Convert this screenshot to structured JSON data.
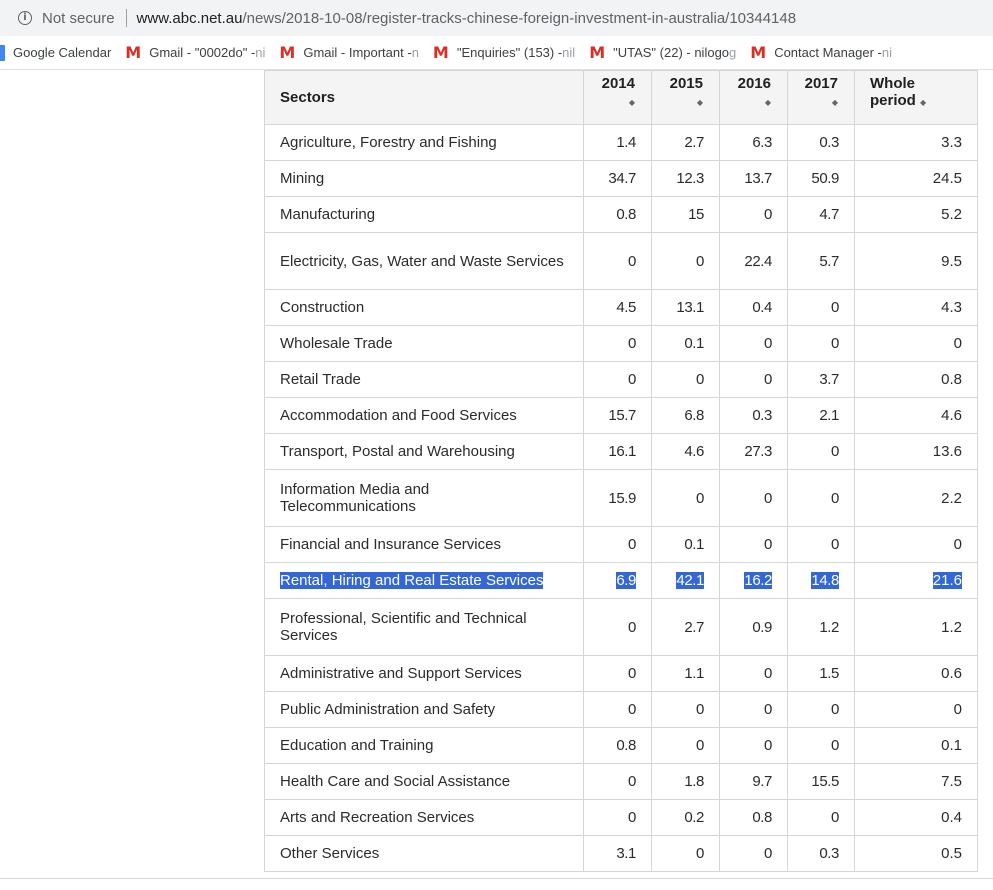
{
  "browser": {
    "security": "Not secure",
    "url_host": "www.abc.net.au",
    "url_path": "/news/2018-10-08/register-tracks-chinese-foreign-investment-in-australia/10344148"
  },
  "bookmarks": [
    {
      "label": "Google Calendar",
      "tail": "",
      "icon": "calendar-icon"
    },
    {
      "label": "Gmail - \"0002do\" - ",
      "tail": "ni",
      "icon": "gmail-icon"
    },
    {
      "label": "Gmail - Important - ",
      "tail": "n",
      "icon": "gmail-icon"
    },
    {
      "label": "\"Enquiries\" (153) - ",
      "tail": "nil",
      "icon": "gmail-icon"
    },
    {
      "label": "\"UTAS\" (22) - nilogo",
      "tail": "g",
      "icon": "gmail-icon"
    },
    {
      "label": "Contact Manager - ",
      "tail": "ni",
      "icon": "gmail-icon"
    }
  ],
  "table": {
    "headers": {
      "sector": "Sectors",
      "y2014": "2014",
      "y2015": "2015",
      "y2016": "2016",
      "y2017": "2017",
      "whole1": "Whole",
      "whole2": "period",
      "sort_glyph": "◆"
    },
    "rows": [
      {
        "sector": "Agriculture, Forestry and Fishing",
        "v": [
          "1.4",
          "2.7",
          "6.3",
          "0.3",
          "3.3"
        ]
      },
      {
        "sector": "Mining",
        "v": [
          "34.7",
          "12.3",
          "13.7",
          "50.9",
          "24.5"
        ]
      },
      {
        "sector": "Manufacturing",
        "v": [
          "0.8",
          "15",
          "0",
          "4.7",
          "5.2"
        ]
      },
      {
        "sector": "Electricity, Gas, Water and Waste Services",
        "v": [
          "0",
          "0",
          "22.4",
          "5.7",
          "9.5"
        ]
      },
      {
        "sector": "Construction",
        "v": [
          "4.5",
          "13.1",
          "0.4",
          "0",
          "4.3"
        ]
      },
      {
        "sector": "Wholesale Trade",
        "v": [
          "0",
          "0.1",
          "0",
          "0",
          "0"
        ]
      },
      {
        "sector": "Retail Trade",
        "v": [
          "0",
          "0",
          "0",
          "3.7",
          "0.8"
        ]
      },
      {
        "sector": "Accommodation and Food Services",
        "v": [
          "15.7",
          "6.8",
          "0.3",
          "2.1",
          "4.6"
        ]
      },
      {
        "sector": "Transport, Postal and Warehousing",
        "v": [
          "16.1",
          "4.6",
          "27.3",
          "0",
          "13.6"
        ]
      },
      {
        "sector": "Information Media and Telecommunications",
        "v": [
          "15.9",
          "0",
          "0",
          "0",
          "2.2"
        ]
      },
      {
        "sector": "Financial and Insurance Services",
        "v": [
          "0",
          "0.1",
          "0",
          "0",
          "0"
        ]
      },
      {
        "sector": "Rental, Hiring and Real Estate Services",
        "v": [
          "6.9",
          "42.1",
          "16.2",
          "14.8",
          "21.6"
        ],
        "highlight": true
      },
      {
        "sector": "Professional, Scientific and Technical Services",
        "v": [
          "0",
          "2.7",
          "0.9",
          "1.2",
          "1.2"
        ]
      },
      {
        "sector": "Administrative and Support Services",
        "v": [
          "0",
          "1.1",
          "0",
          "1.5",
          "0.6"
        ]
      },
      {
        "sector": "Public Administration and Safety",
        "v": [
          "0",
          "0",
          "0",
          "0",
          "0"
        ]
      },
      {
        "sector": "Education and Training",
        "v": [
          "0.8",
          "0",
          "0",
          "0",
          "0.1"
        ]
      },
      {
        "sector": "Health Care and Social Assistance",
        "v": [
          "0",
          "1.8",
          "9.7",
          "15.5",
          "7.5"
        ]
      },
      {
        "sector": "Arts and Recreation Services",
        "v": [
          "0",
          "0.2",
          "0.8",
          "0",
          "0.4"
        ]
      },
      {
        "sector": "Other Services",
        "v": [
          "3.1",
          "0",
          "0",
          "0.3",
          "0.5"
        ]
      }
    ]
  },
  "colors": {
    "selection": "#3367d6",
    "header_bg": "#f4f4f4",
    "border": "#d6d6d6"
  }
}
